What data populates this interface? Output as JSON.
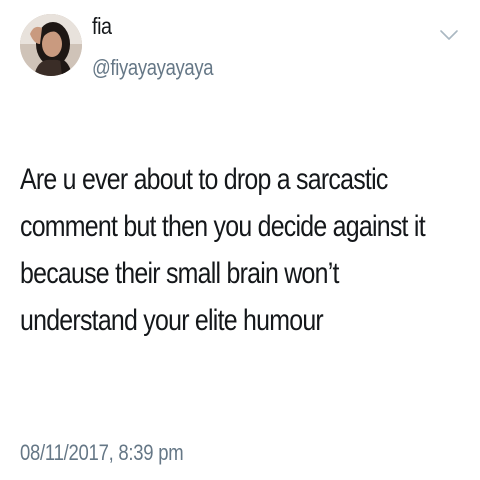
{
  "tweet": {
    "author": {
      "display_name": "fia",
      "handle": "@fiyayayayaya",
      "avatar_icon": "user-avatar-photo"
    },
    "menu_icon": "chevron-down-icon",
    "text_lines": [
      "Are u ever about to drop a sarcastic",
      "comment but then you decide against it",
      "because their small brain won’t",
      "understand your elite humour"
    ],
    "timestamp": "08/11/2017, 8:39 pm"
  },
  "colors": {
    "primary_text": "#14171a",
    "secondary_text": "#657786",
    "background": "#ffffff"
  }
}
